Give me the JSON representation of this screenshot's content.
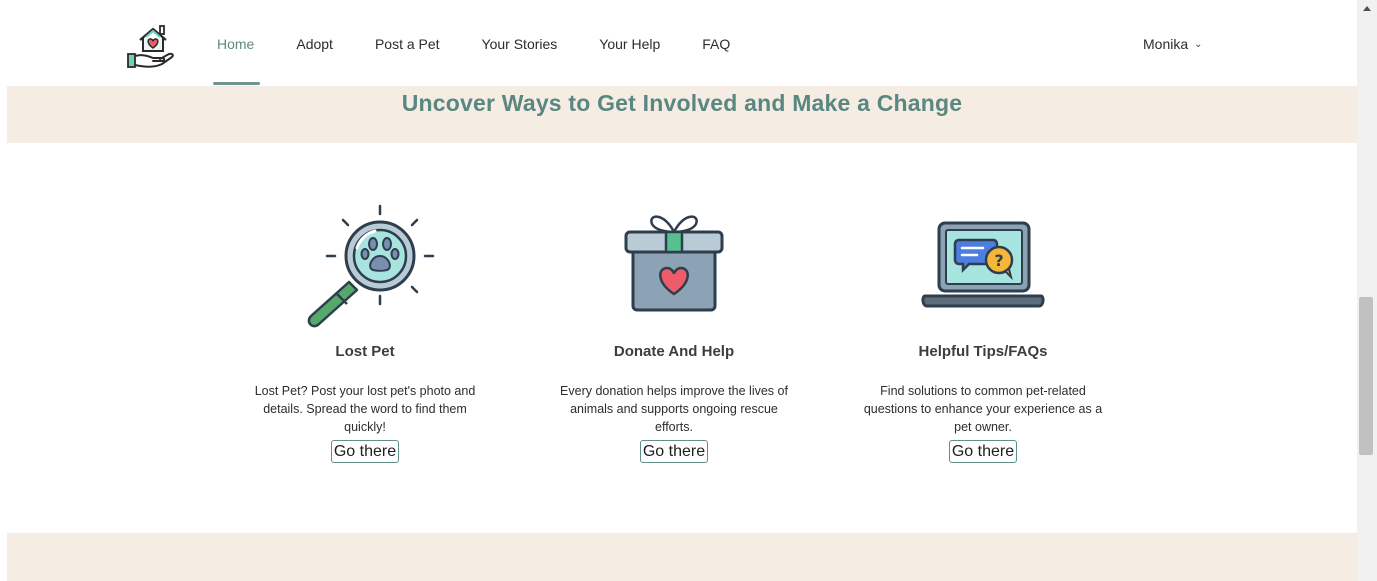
{
  "nav": {
    "items": [
      {
        "label": "Home",
        "active": true
      },
      {
        "label": "Adopt"
      },
      {
        "label": "Post a Pet"
      },
      {
        "label": "Your Stories"
      },
      {
        "label": "Your Help"
      },
      {
        "label": "FAQ"
      }
    ],
    "user": "Monika"
  },
  "heading": "Uncover Ways to Get Involved and Make a Change",
  "cards": [
    {
      "title": "Lost Pet",
      "text": "Lost Pet? Post your lost pet's photo and details. Spread the word to find them quickly!",
      "button": "Go there",
      "icon": "magnifier-paw-icon"
    },
    {
      "title": "Donate And Help",
      "text": "Every donation helps improve the lives of animals and supports ongoing rescue efforts.",
      "button": "Go there",
      "icon": "gift-box-heart-icon"
    },
    {
      "title": "Helpful Tips/FAQs",
      "text": "Find solutions to common pet-related questions to enhance your experience as a pet owner.",
      "button": "Go there",
      "icon": "laptop-chat-icon"
    }
  ],
  "colors": {
    "accent": "#5b8781",
    "band": "#f5ece4"
  }
}
